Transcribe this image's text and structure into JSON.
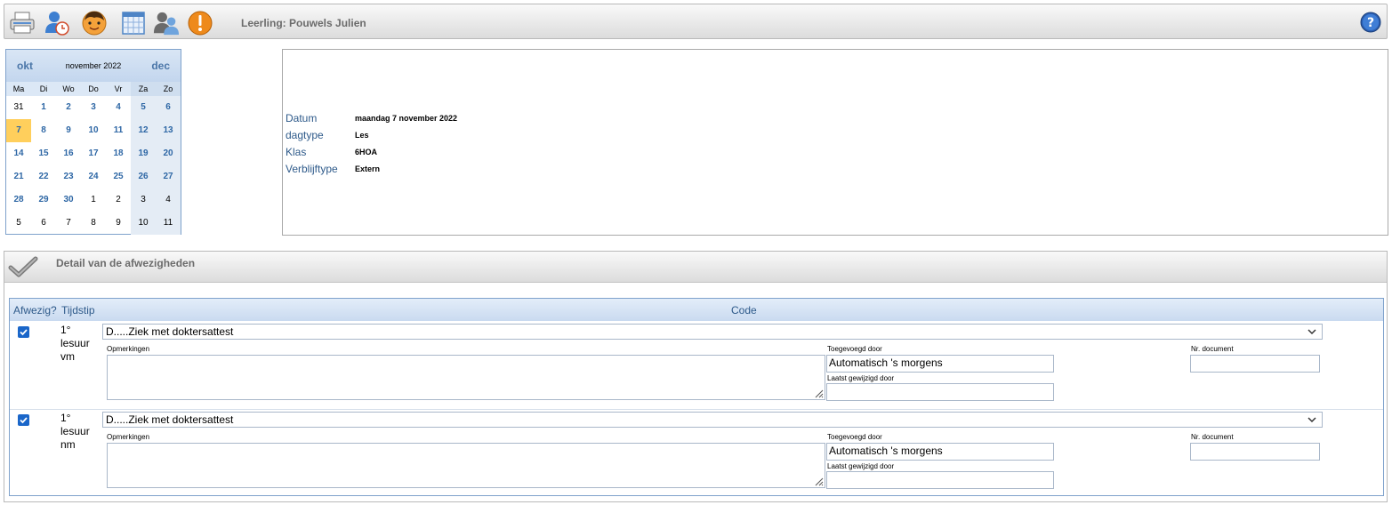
{
  "toolbar": {
    "title": "Leerling: Pouwels Julien",
    "icons": [
      "printer-icon",
      "user-clock-icon",
      "student-face-icon",
      "calendar-icon",
      "users-icon",
      "warning-icon"
    ],
    "help_icon": "help-icon"
  },
  "calendar": {
    "prev": "okt",
    "month": "november 2022",
    "next": "dec",
    "weekdays": [
      "Ma",
      "Di",
      "Wo",
      "Do",
      "Vr",
      "Za",
      "Zo"
    ],
    "weeks": [
      [
        "31",
        "1",
        "2",
        "3",
        "4",
        "5",
        "6"
      ],
      [
        "7",
        "8",
        "9",
        "10",
        "11",
        "12",
        "13"
      ],
      [
        "14",
        "15",
        "16",
        "17",
        "18",
        "19",
        "20"
      ],
      [
        "21",
        "22",
        "23",
        "24",
        "25",
        "26",
        "27"
      ],
      [
        "28",
        "29",
        "30",
        "1",
        "2",
        "3",
        "4"
      ],
      [
        "5",
        "6",
        "7",
        "8",
        "9",
        "10",
        "11"
      ]
    ],
    "selected": "7"
  },
  "info": {
    "datum_label": "Datum",
    "datum_value": "maandag 7 november 2022",
    "dagtype_label": "dagtype",
    "dagtype_value": "Les",
    "klas_label": "Klas",
    "klas_value": "6HOA",
    "verblijf_label": "Verblijftype",
    "verblijf_value": "Extern"
  },
  "detail": {
    "title": "Detail van de afwezigheden",
    "headers": {
      "afwezig": "Afwezig?",
      "tijdstip": "Tijdstip",
      "code": "Code"
    },
    "rows": [
      {
        "checked": true,
        "tijdstip": "1° lesuur vm",
        "code": "D.....Ziek met doktersattest",
        "opmerkingen_label": "Opmerkingen",
        "opmerkingen": "",
        "toegevoegd_label": "Toegevoegd door",
        "toegevoegd": "Automatisch 's morgens",
        "gewijzigd_label": "Laatst gewijzigd door",
        "gewijzigd": "",
        "nrdoc_label": "Nr. document",
        "nrdoc": ""
      },
      {
        "checked": true,
        "tijdstip": "1° lesuur nm",
        "code": "D.....Ziek met doktersattest",
        "opmerkingen_label": "Opmerkingen",
        "opmerkingen": "",
        "toegevoegd_label": "Toegevoegd door",
        "toegevoegd": "Automatisch 's morgens",
        "gewijzigd_label": "Laatst gewijzigd door",
        "gewijzigd": "",
        "nrdoc_label": "Nr. document",
        "nrdoc": ""
      }
    ]
  }
}
